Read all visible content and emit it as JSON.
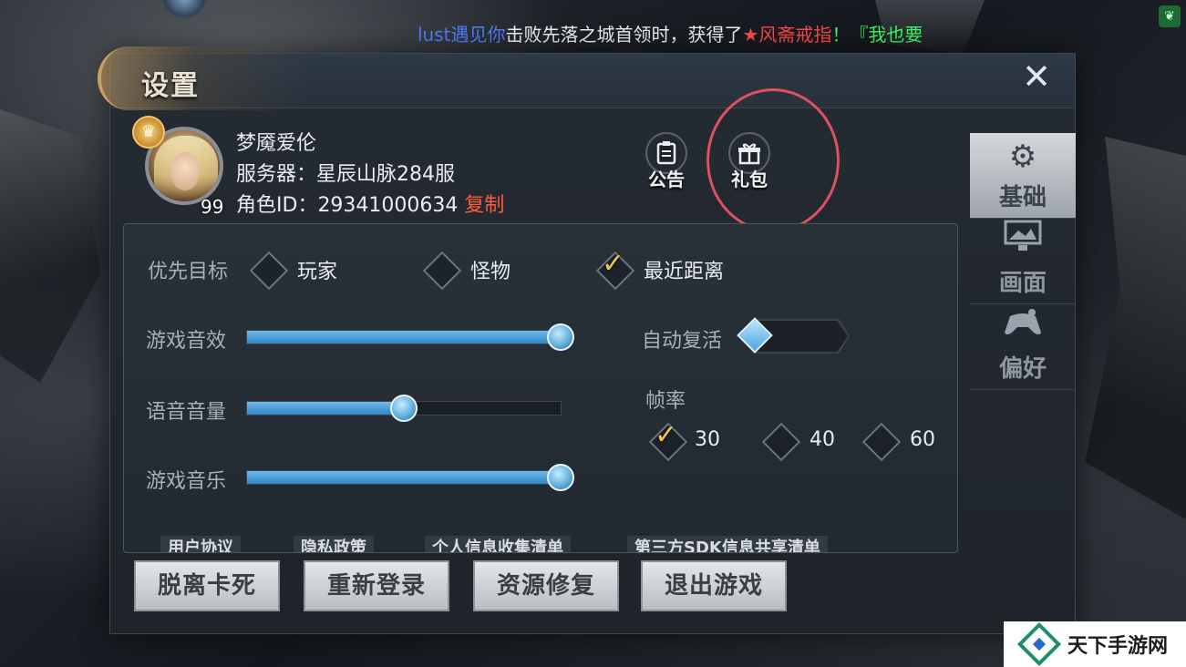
{
  "ticker": {
    "part1": "lust遇见你",
    "part2": "击败先落之城首领时，",
    "part3": "获得了",
    "part4": "★风斋戒指",
    "part5": "！『我也要"
  },
  "dialog": {
    "title": "设置",
    "close_icon": "✕"
  },
  "profile": {
    "name": "梦魇爱伦",
    "server_label": "服务器：",
    "server_value": "星辰山脉284服",
    "role_label": "角色ID：",
    "role_id": "29341000634",
    "copy_label": "复制",
    "level": "99"
  },
  "actions": {
    "notice_label": "公告",
    "gift_label": "礼包"
  },
  "settings": {
    "priority_target_label": "优先目标",
    "priority_options": [
      "玩家",
      "怪物",
      "最近距离"
    ],
    "priority_selected": "最近距离",
    "sfx_label": "游戏音效",
    "sfx_level": 1.0,
    "voice_label": "语音音量",
    "voice_level": 0.5,
    "music_label": "游戏音乐",
    "music_level": 1.0,
    "auto_revive_label": "自动复活",
    "auto_revive_on": false,
    "framerate_label": "帧率",
    "framerate_options": [
      "30",
      "40",
      "60"
    ],
    "framerate_selected": "30"
  },
  "policy_links": [
    "用户协议",
    "隐私政策",
    "个人信息收集清单",
    "第三方SDK信息共享清单"
  ],
  "bottom_buttons": [
    "脱离卡死",
    "重新登录",
    "资源修复",
    "退出游戏"
  ],
  "side_tabs": [
    {
      "label": "基础",
      "icon": "gear-icon",
      "active": true
    },
    {
      "label": "画面",
      "icon": "monitor-icon",
      "active": false
    },
    {
      "label": "偏好",
      "icon": "gamepad-icon",
      "active": false
    }
  ],
  "watermark": {
    "text": "天下手游网"
  },
  "colors": {
    "accent_gold": "#c9a060",
    "slider_blue": "#2f86c6",
    "copy_red": "#ff5a3a",
    "highlight_ring": "#e0505e"
  }
}
